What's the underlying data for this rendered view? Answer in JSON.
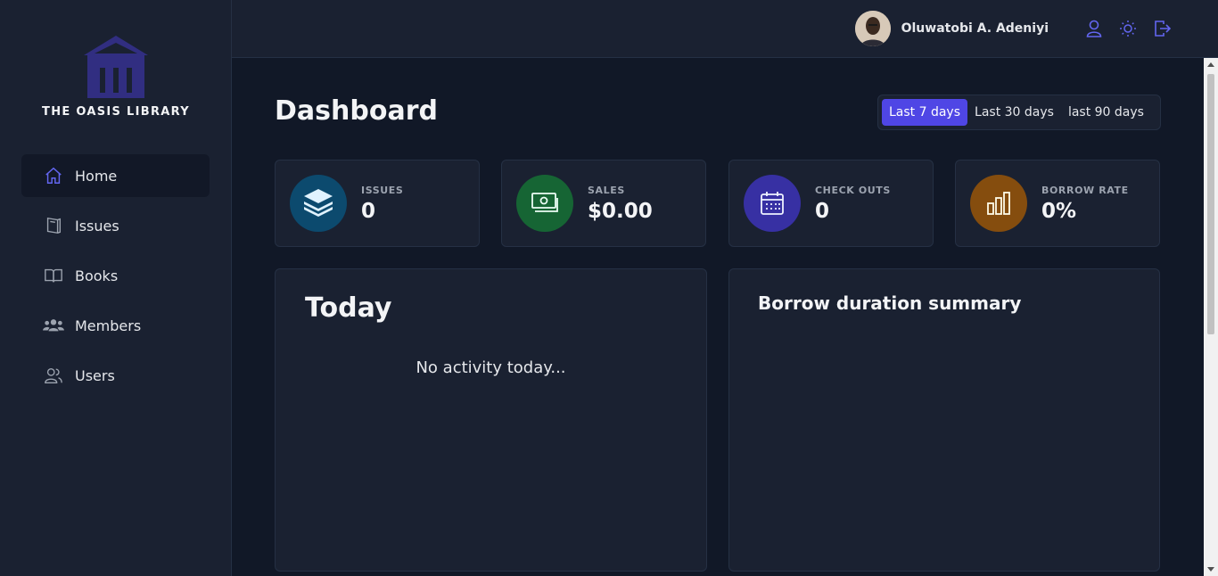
{
  "brand": {
    "name": "THE OASIS LIBRARY",
    "color": "#312e81"
  },
  "sidebar": {
    "items": [
      {
        "label": "Home",
        "icon": "home-icon",
        "active": true
      },
      {
        "label": "Issues",
        "icon": "book-issue-icon"
      },
      {
        "label": "Books",
        "icon": "open-book-icon"
      },
      {
        "label": "Members",
        "icon": "users-group-icon"
      },
      {
        "label": "Users",
        "icon": "users-icon"
      }
    ]
  },
  "header": {
    "user_name": "Oluwatobi A. Adeniyi",
    "icons": [
      "profile-icon",
      "sun-icon",
      "logout-icon"
    ],
    "accent": "#4f46e5"
  },
  "main": {
    "title": "Dashboard",
    "ranges": [
      {
        "label": "Last 7 days",
        "active": true
      },
      {
        "label": "Last 30 days"
      },
      {
        "label": "last 90 days"
      }
    ],
    "stats": [
      {
        "label": "ISSUES",
        "value": "0",
        "icon": "books-stack-icon",
        "color": "#0c4a6e"
      },
      {
        "label": "SALES",
        "value": "$0.00",
        "icon": "cash-icon",
        "color": "#14532d"
      },
      {
        "label": "CHECK OUTS",
        "value": "0",
        "icon": "calendar-icon",
        "color": "#3730a3"
      },
      {
        "label": "BORROW RATE",
        "value": "0%",
        "icon": "bar-chart-icon",
        "color": "#854d0e"
      }
    ],
    "today": {
      "title": "Today",
      "empty_text": "No activity today..."
    },
    "borrow_summary": {
      "title": "Borrow duration summary"
    }
  }
}
